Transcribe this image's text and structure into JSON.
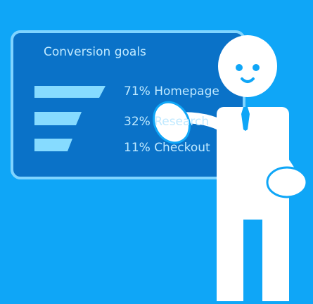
{
  "board": {
    "title": "Conversion goals",
    "goals": [
      {
        "label": "71% Homepage",
        "value": 71
      },
      {
        "label": "32% Research",
        "value": 32
      },
      {
        "label": "11% Checkout",
        "value": 11
      }
    ]
  },
  "colors": {
    "background": "#0FA6F7",
    "board_fill": "#0A72C8",
    "board_border": "#7FD4FF",
    "bar_fill": "#86DBFF",
    "text": "#BFE9FF",
    "figure": "#FFFFFF",
    "tie": "#0FA6F7"
  }
}
